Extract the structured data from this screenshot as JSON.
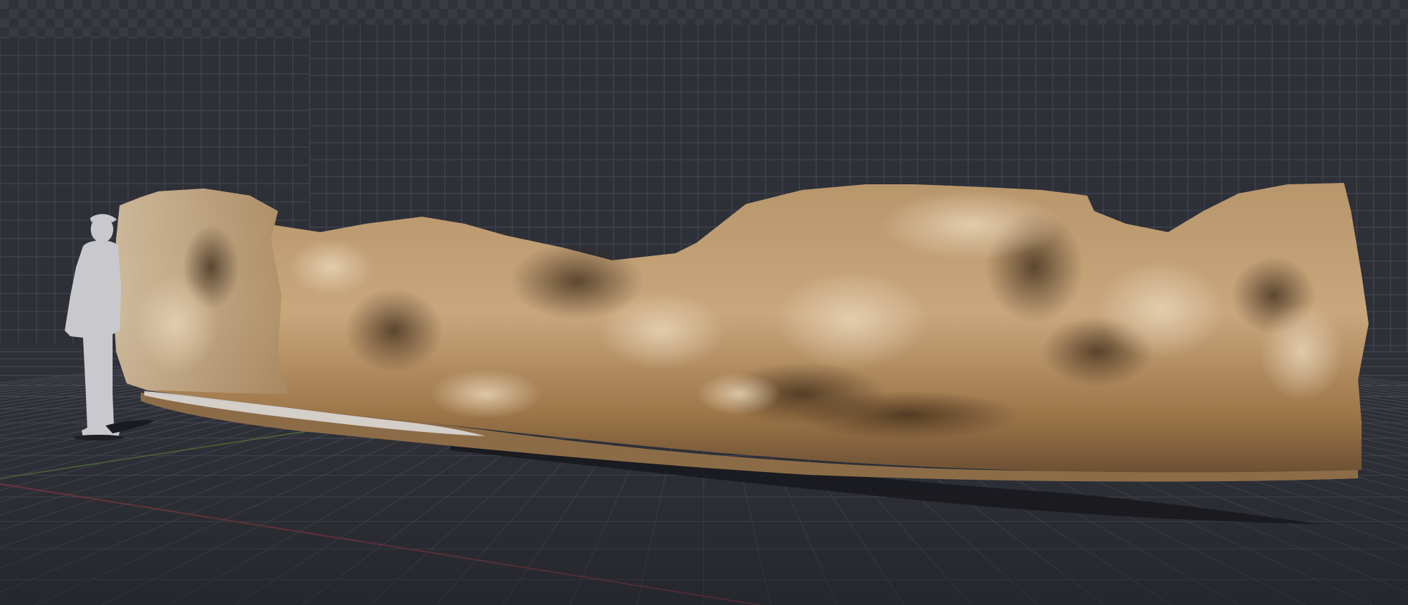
{
  "scene": {
    "kind": "3d-viewport-render",
    "subject": "rock-wall-scan",
    "scale_reference": "human-silhouette",
    "colors": {
      "backdrop": "#2b2d35",
      "floor": "#2f3138",
      "grid_line": "#4a4c55",
      "x_axis": "#8a3b45",
      "y_axis": "#5b7a3a",
      "rock_light": "#c9a77d",
      "rock_mid": "#a27a4c",
      "rock_dark": "#5e4127",
      "silhouette": "#c8c8cc",
      "shadow": "#17181c"
    }
  }
}
